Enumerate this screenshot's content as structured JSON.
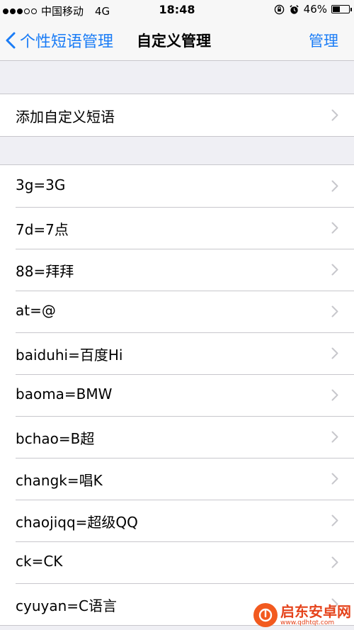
{
  "status_bar": {
    "carrier": "中国移动",
    "network": "4G",
    "time": "18:48",
    "battery": "46%",
    "battery_level": 0.46,
    "signal_bars_filled": 3,
    "signal_bars_total": 5
  },
  "nav": {
    "back_label": "个性短语管理",
    "title": "自定义管理",
    "action_label": "管理"
  },
  "add_row": {
    "label": "添加自定义短语"
  },
  "phrases": [
    {
      "label": "3g=3G"
    },
    {
      "label": "7d=7点"
    },
    {
      "label": "88=拜拜"
    },
    {
      "label": "at=@"
    },
    {
      "label": "baiduhi=百度Hi"
    },
    {
      "label": "baoma=BMW"
    },
    {
      "label": "bchao=B超"
    },
    {
      "label": "changk=唱K"
    },
    {
      "label": "chaojiqq=超级QQ"
    },
    {
      "label": "ck=CK"
    },
    {
      "label": "cyuyan=C语言"
    }
  ],
  "watermark": {
    "name": "启东安卓网",
    "url": "www.qdhtqt.com"
  },
  "colors": {
    "accent": "#1a7cf6",
    "background": "#efeff4",
    "separator": "#c8c7cc",
    "chevron": "#c7c7cc",
    "watermark": "#e5431b"
  }
}
